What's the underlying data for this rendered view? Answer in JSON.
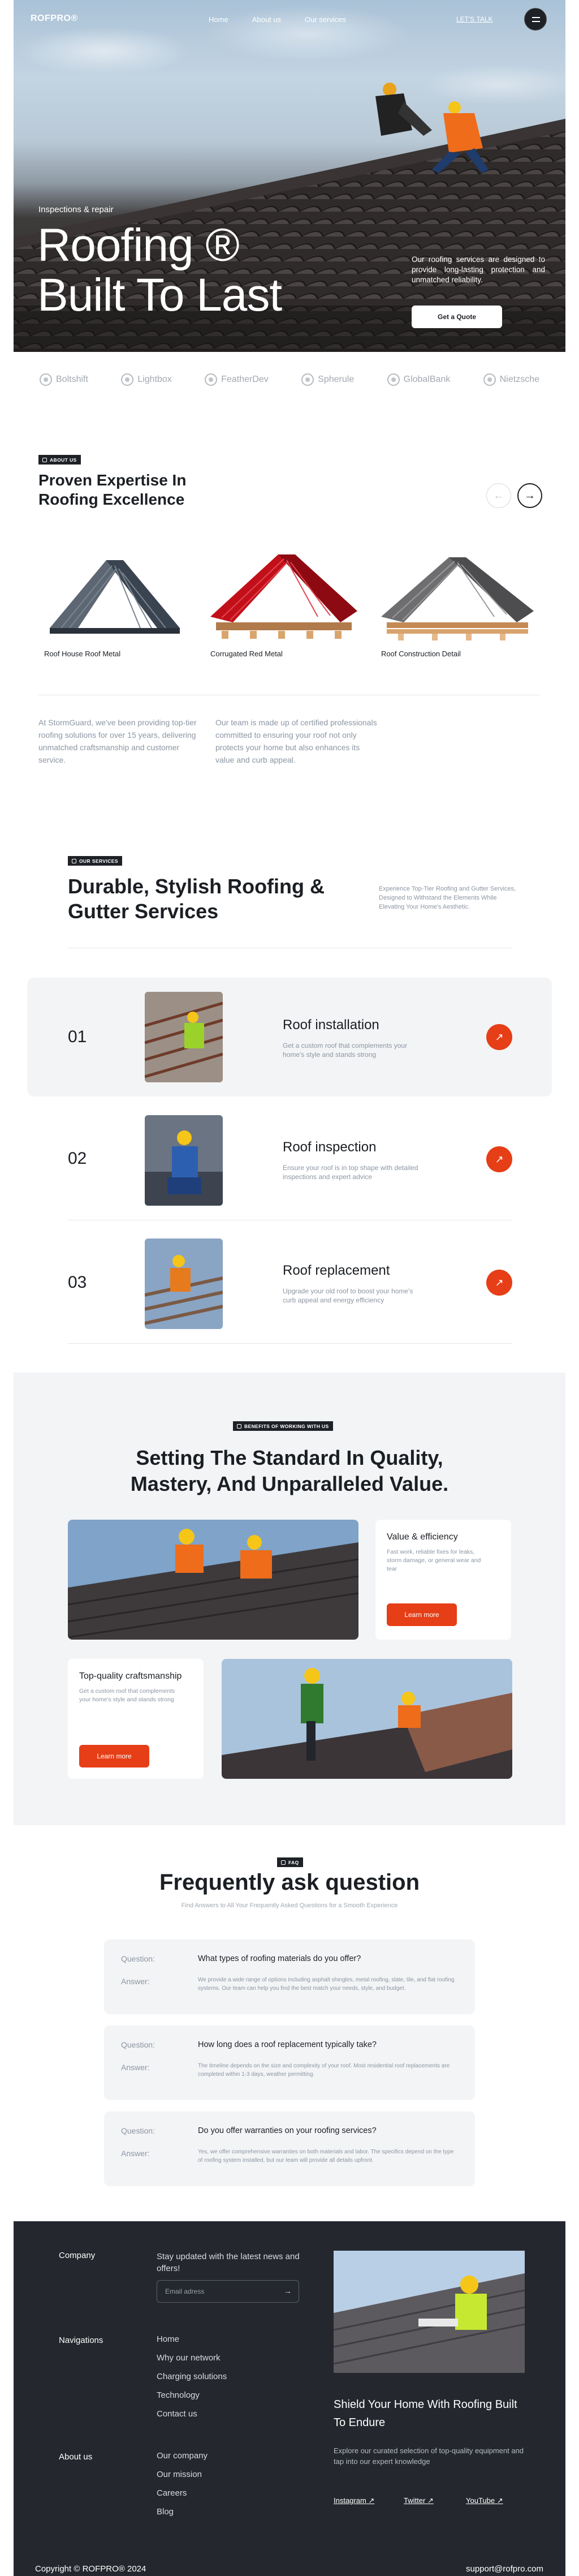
{
  "header": {
    "logo": "ROFPRO®",
    "nav": [
      "Home",
      "About us",
      "Our services"
    ],
    "cta": "LET'S TALK"
  },
  "hero": {
    "eyebrow": "Inspections & repair",
    "title_line1": "Roofing ®",
    "title_line2": "Built To Last",
    "description": "Our roofing services are designed to provide long-lasting protection and unmatched reliability.",
    "button": "Get a Quote"
  },
  "brands": [
    "Boltshift",
    "Lightbox",
    "FeatherDev",
    "Spherule",
    "GlobalBank",
    "Nietzsche"
  ],
  "about": {
    "tag": "ABOUT US",
    "title": "Proven Expertise In Roofing Excellence",
    "products": [
      "Roof House Roof Metal",
      "Corrugated Red Metal",
      "Roof Construction Detail"
    ],
    "text_left": "At StormGuard, we've been providing top-tier roofing solutions for over 15 years, delivering unmatched craftsmanship and customer service.",
    "text_right": "Our team is made up of certified professionals committed to ensuring your roof not only protects your home but also enhances its value and curb appeal."
  },
  "services": {
    "tag": "OUR SERVICES",
    "title": "Durable, Stylish Roofing & Gutter Services",
    "side_text": "Experience Top-Tier Roofing and Gutter Services, Designed to Withstand the Elements While Elevating Your Home's Aesthetic.",
    "items": [
      {
        "num": "01",
        "name": "Roof installation",
        "desc": "Get a custom roof that complements your home's style and stands strong"
      },
      {
        "num": "02",
        "name": "Roof inspection",
        "desc": "Ensure your roof is in top shape with detailed inspections and expert advice"
      },
      {
        "num": "03",
        "name": "Roof replacement",
        "desc": "Upgrade your old roof to boost your home's curb appeal and energy efficiency"
      }
    ]
  },
  "benefits": {
    "tag": "BENEFITS OF WORKING WITH US",
    "title_line1": "Setting The Standard In Quality,",
    "title_line2": "Mastery, And Unparalleled Value.",
    "card1": {
      "title": "Value & efficiency",
      "desc": "Fast work, reliable fixes for leaks, storm damage, or general wear and tear",
      "button": "Learn more"
    },
    "card2": {
      "title": "Top-quality craftsmanship",
      "desc": "Get a custom roof that complements your home's style and stands strong",
      "button": "Learn more"
    }
  },
  "faq": {
    "tag": "FAQ",
    "title": "Frequently ask question",
    "subtitle": "Find Answers to All Your Frequently Asked Questions for a Smooth Experience",
    "question_label": "Question:",
    "answer_label": "Answer:",
    "items": [
      {
        "q": "What types of roofing materials do you offer?",
        "a": "We provide a wide range of options including asphalt shingles, metal roofing, slate, tile, and flat roofing systems. Our team can help you find the best match your needs, style, and budget."
      },
      {
        "q": "How long does a roof replacement typically take?",
        "a": "The timeline depends on the size and complexity of your roof. Most residential roof replacements are completed within 1-3 days, weather permitting."
      },
      {
        "q": "Do you offer warranties on your roofing services?",
        "a": "Yes, we offer comprehensive warranties on both materials and labor. The specifics depend on the type of roofing system installed, but our team will provide all details upfront."
      }
    ]
  },
  "footer": {
    "company_heading": "Company",
    "newsletter": "Stay updated with the latest news and offers!",
    "email_placeholder": "Email adress",
    "nav_heading": "Navigations",
    "nav_links": [
      "Home",
      "Why our network",
      "Charging solutions",
      "Technology",
      "Contact us"
    ],
    "about_heading": "About us",
    "about_links": [
      "Our company",
      "Our mission",
      "Careers",
      "Blog"
    ],
    "cta_title": "Shield Your Home With Roofing Built To Endure",
    "cta_desc": "Explore our curated selection of top-quality equipment and tap into our expert knowledge",
    "social": [
      "Instagram",
      "Twitter",
      "YouTube"
    ],
    "copyright": "Copyright © ROFPRO® 2024",
    "email": "support@rofpro.com"
  },
  "colors": {
    "accent": "#e63e16",
    "dark": "#24282e",
    "light_bg": "#f3f4f6"
  }
}
